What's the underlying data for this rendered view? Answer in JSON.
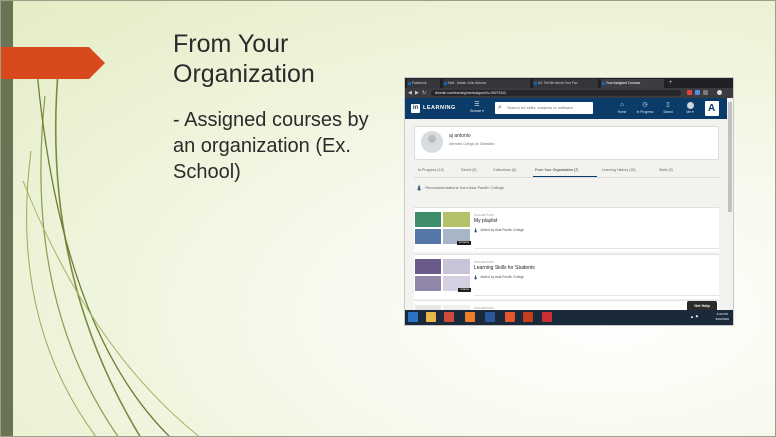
{
  "slide": {
    "title": "From Your Organization",
    "bullet": "- Assigned courses by an organization (Ex. School)"
  },
  "browser": {
    "tabs": [
      {
        "label": "Facebook",
        "active": false
      },
      {
        "label": "Mail - Adrian John Antonio",
        "active": false
      },
      {
        "label": "A2: Tell Me About Your Fav",
        "active": false
      },
      {
        "label": "Your Assigned Courses",
        "active": true
      }
    ],
    "url": "linkedin.com/learning/me/assigned?u=35279240"
  },
  "linkedin": {
    "logo_in": "in",
    "logo_word": "LEARNING",
    "browse_label": "Browse ▾",
    "search_placeholder": "Search for skills, subjects or software",
    "nav": [
      {
        "icon": "home-icon",
        "glyph": "⌂",
        "label": "Home"
      },
      {
        "icon": "clock-icon",
        "glyph": "◷",
        "label": "In Progress"
      },
      {
        "icon": "bookmark-icon",
        "glyph": "▯",
        "label": "Saved"
      },
      {
        "icon": "avatar",
        "glyph": "",
        "label": "Me ▾"
      }
    ],
    "brand_glyph": "A"
  },
  "profile": {
    "name": "aj antonio",
    "org": "Attended Colegio de Sebastian"
  },
  "tabs": [
    {
      "label": "In Progress (19)",
      "active": false
    },
    {
      "label": "Saved (9)",
      "active": false
    },
    {
      "label": "Collections (6)",
      "active": false
    },
    {
      "label": "From Your Organization (7)",
      "active": true
    },
    {
      "label": "Learning History (18)",
      "active": false
    },
    {
      "label": "Skills (5)",
      "active": false
    }
  ],
  "recommendations_label": "Recommendations from Asia Pacific College",
  "cards": [
    {
      "type": "COLLECTION",
      "title": "My playlist",
      "added_by": "Added by Asia Pacific College",
      "badge": "12 items",
      "thumb_colors": [
        "#3e8e6b",
        "#b4c26a",
        "#5577a8",
        "#a7b6c6"
      ]
    },
    {
      "type": "COLLECTION",
      "title": "Learning Skills for Students",
      "added_by": "Added by Asia Pacific College",
      "badge": "2 items",
      "thumb_colors": [
        "#6a5a8c",
        "#c9c3d8",
        "#8f86a8",
        "#d6d1e2"
      ]
    },
    {
      "type": "COLLECTION",
      "title": "",
      "added_by": "",
      "badge": "",
      "thumb_colors": [
        "#e7e7e7",
        "#efefef",
        "#e7e7e7",
        "#efefef"
      ]
    }
  ],
  "get_help": "Get Help",
  "taskbar": {
    "apps": [
      {
        "icon": "windows-start-icon",
        "color": "#2a72c7"
      },
      {
        "icon": "file-explorer-icon",
        "color": "#e8b94a"
      },
      {
        "icon": "chrome-icon",
        "color": "#d04a3a"
      },
      {
        "icon": "sublime-icon",
        "color": "#f07d2a"
      },
      {
        "icon": "word-icon",
        "color": "#2b579a"
      },
      {
        "icon": "brave-icon",
        "color": "#e4572e"
      },
      {
        "icon": "powerpoint-icon",
        "color": "#c43e1c"
      },
      {
        "icon": "snipping-icon",
        "color": "#cc2f2f"
      }
    ],
    "tray": "▲ ⚑",
    "time": "6:22 PM",
    "date": "6/30/2020"
  }
}
